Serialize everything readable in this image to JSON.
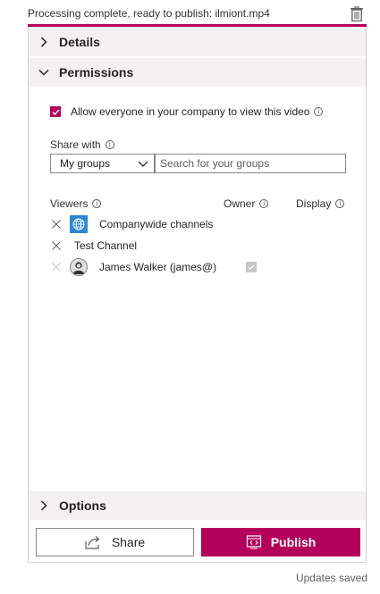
{
  "status": {
    "message": "Processing complete, ready to publish: ilmiont.mp4",
    "delete_icon": "trash-icon"
  },
  "colors": {
    "accent": "#b4005b",
    "section_bg": "#f3f2f1",
    "globe": "#2b88d8"
  },
  "sections": {
    "details": "Details",
    "permissions": "Permissions",
    "options": "Options"
  },
  "permissions": {
    "allow_everyone_label": "Allow everyone in your company to view this video",
    "allow_everyone_checked": true,
    "share_with_label": "Share with",
    "dropdown_value": "My groups",
    "search_placeholder": "Search for your groups",
    "columns": {
      "viewers": "Viewers",
      "owner": "Owner",
      "display": "Display"
    },
    "viewers": [
      {
        "name": "Companywide channels",
        "icon": "globe-icon"
      },
      {
        "name": "Test Channel"
      },
      {
        "name": "James Walker (james@)",
        "icon": "avatar",
        "owner_checked": true
      }
    ]
  },
  "actions": {
    "share_label": "Share",
    "publish_label": "Publish"
  },
  "footer": {
    "updates_saved": "Updates saved"
  }
}
